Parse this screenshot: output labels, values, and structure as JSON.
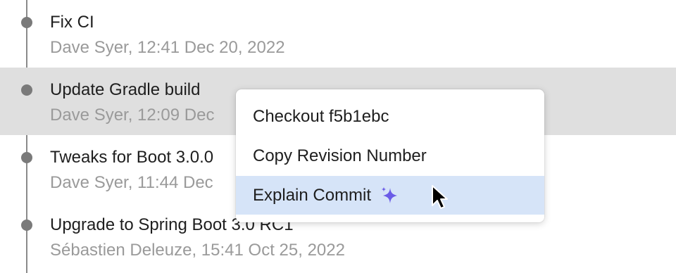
{
  "commits": [
    {
      "message": "Fix CI",
      "meta": "Dave Syer, 12:41 Dec 20, 2022"
    },
    {
      "message": "Update Gradle build",
      "meta": "Dave Syer, 12:09 Dec"
    },
    {
      "message": "Tweaks for Boot 3.0.0",
      "meta": "Dave Syer, 11:44 Dec"
    },
    {
      "message": "Upgrade to Spring Boot 3.0 RC1",
      "meta": "Sébastien Deleuze, 15:41 Oct 25, 2022"
    }
  ],
  "context_menu": {
    "items": [
      {
        "label": "Checkout f5b1ebc"
      },
      {
        "label": "Copy Revision Number"
      },
      {
        "label": "Explain Commit",
        "icon": "sparkle-icon"
      }
    ]
  },
  "colors": {
    "selected_row": "#dfdfdf",
    "menu_highlight": "#d6e4f8",
    "sparkle": "#6b5ce7"
  }
}
